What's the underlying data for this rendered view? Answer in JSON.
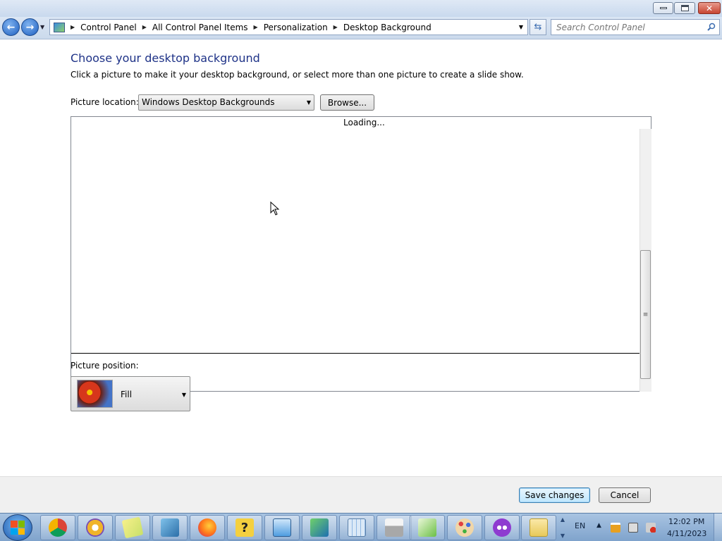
{
  "window": {
    "controls": {
      "minimize": "minimize",
      "maximize": "maximize",
      "close": "close"
    }
  },
  "navigation": {
    "breadcrumbs": [
      "Control Panel",
      "All Control Panel Items",
      "Personalization",
      "Desktop Background"
    ],
    "search_placeholder": "Search Control Panel"
  },
  "main": {
    "title": "Choose your desktop background",
    "subtitle": "Click a picture to make it your desktop background, or select more than one picture to create a slide show.",
    "picture_location_label": "Picture location:",
    "picture_location_value": "Windows Desktop Backgrounds",
    "browse_label": "Browse...",
    "loading_text": "Loading...",
    "picture_position_label": "Picture position:",
    "picture_position_value": "Fill"
  },
  "actions": {
    "save_label": "Save changes",
    "cancel_label": "Cancel"
  },
  "taskbar": {
    "pinned": [
      {
        "name": "chrome-icon",
        "color": "#e8453c"
      },
      {
        "name": "keepass-icon",
        "color": "#f0b429"
      },
      {
        "name": "sticky-notes-icon",
        "color": "#c8e06a"
      },
      {
        "name": "network-cube-icon",
        "color": "#3b8dc8"
      },
      {
        "name": "firefox-icon",
        "color": "#ff7a1a"
      },
      {
        "name": "help-icon",
        "color": "#f4d03f"
      },
      {
        "name": "control-panel-icon",
        "color": "#4f9de0"
      },
      {
        "name": "remote-desktop-icon",
        "color": "#2c8a4a"
      },
      {
        "name": "calculator-icon",
        "color": "#8fb7e3"
      },
      {
        "name": "printer-icon",
        "color": "#a8a8a8"
      },
      {
        "name": "chart-editor-icon",
        "color": "#6bbf45"
      },
      {
        "name": "paint-icon",
        "color": "#e0a040"
      },
      {
        "name": "mask-app-icon",
        "color": "#8e3bd0"
      },
      {
        "name": "file-explorer-icon",
        "color": "#e8c95a"
      }
    ],
    "language": "EN",
    "time": "12:02 PM",
    "date": "4/11/2023"
  }
}
